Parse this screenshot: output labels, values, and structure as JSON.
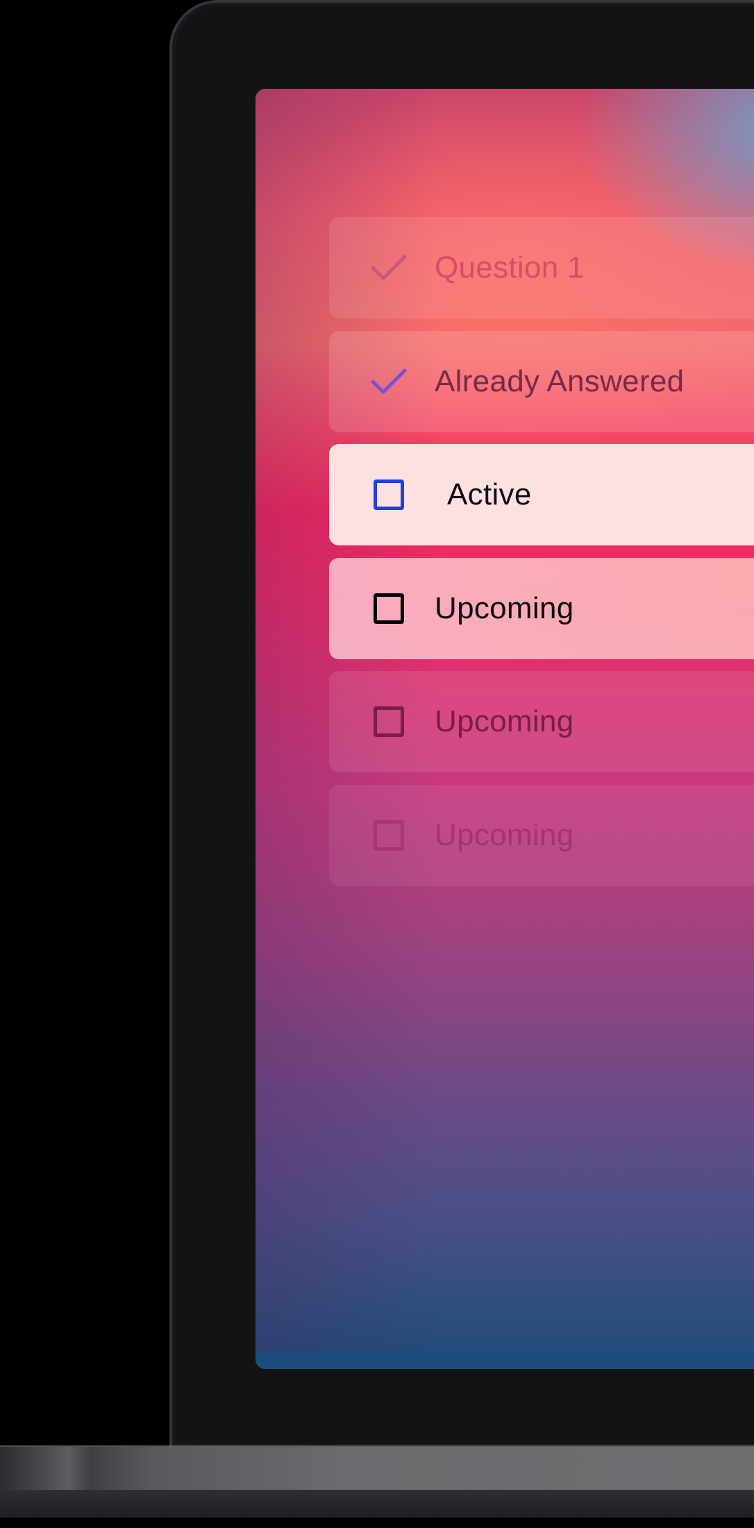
{
  "questions": [
    {
      "label": "Question 1",
      "state": "answered",
      "icon": "check-icon"
    },
    {
      "label": "Already Answered",
      "state": "answered",
      "icon": "check-icon"
    },
    {
      "label": "Active",
      "state": "active",
      "icon": "checkbox-icon"
    },
    {
      "label": "Upcoming",
      "state": "upcoming",
      "icon": "checkbox-icon"
    },
    {
      "label": "Upcoming",
      "state": "upcoming",
      "icon": "checkbox-icon"
    },
    {
      "label": "Upcoming",
      "state": "upcoming",
      "icon": "checkbox-icon"
    }
  ],
  "colors": {
    "check": "#7b4fd0",
    "active_checkbox": "#1f3fe0",
    "upcoming_checkbox": "#000000",
    "active_row": "#fde1e1"
  }
}
